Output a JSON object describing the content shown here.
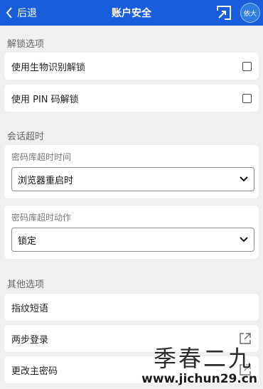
{
  "header": {
    "back_label": "后退",
    "title": "账户安全",
    "avatar_text": "依大"
  },
  "unlock": {
    "section_title": "解锁选项",
    "biometric_label": "使用生物识别解锁",
    "biometric_checked": false,
    "pin_label": "使用 PIN 码解锁",
    "pin_checked": false
  },
  "session": {
    "section_title": "会话超时",
    "timeout_label": "密码库超时时间",
    "timeout_value": "浏览器重启时",
    "action_label": "密码库超时动作",
    "action_value": "锁定"
  },
  "other": {
    "section_title": "其他选项",
    "fingerprint_label": "指纹短语",
    "two_step_label": "两步登录",
    "change_master_label": "更改主密码"
  },
  "watermark": {
    "title": "季春二九",
    "url": "www.jichun29.cn"
  },
  "colors": {
    "accent": "#175ddc",
    "background": "#f0f0f0"
  }
}
